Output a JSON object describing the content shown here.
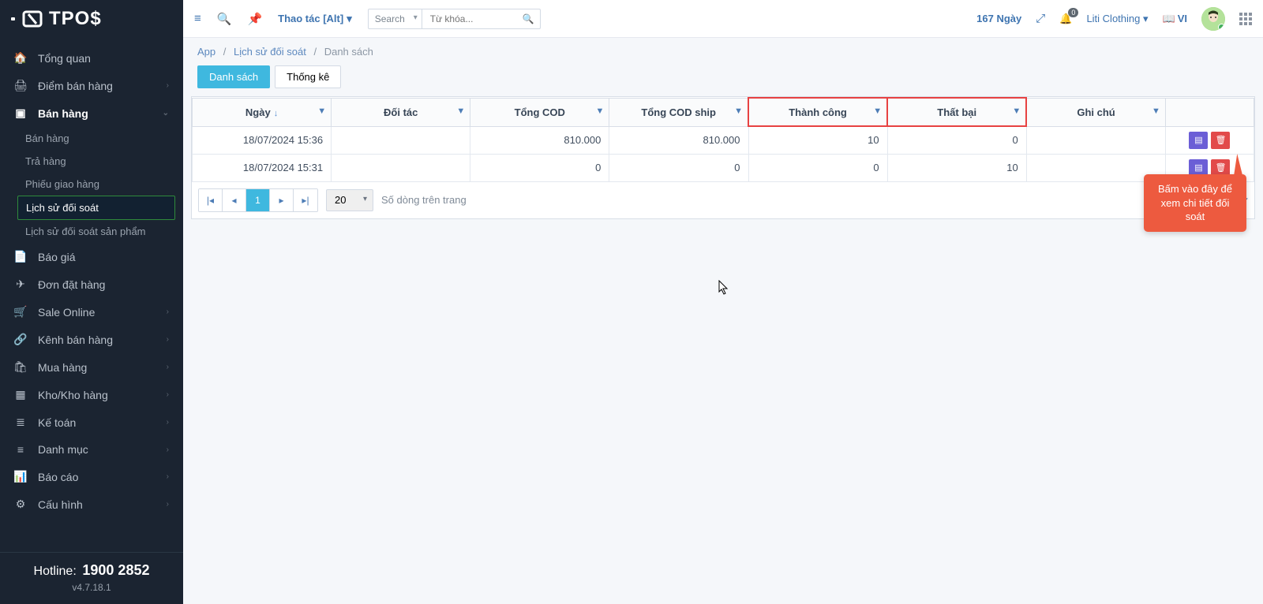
{
  "brand": "TPO$",
  "sidebar": {
    "items": [
      {
        "label": "Tổng quan",
        "icon": "home"
      },
      {
        "label": "Điểm bán hàng",
        "icon": "print"
      },
      {
        "label": "Bán hàng",
        "icon": "book"
      },
      {
        "label": "Báo giá",
        "icon": "file"
      },
      {
        "label": "Đơn đặt hàng",
        "icon": "plane"
      },
      {
        "label": "Sale Online",
        "icon": "cart"
      },
      {
        "label": "Kênh bán hàng",
        "icon": "link"
      },
      {
        "label": "Mua hàng",
        "icon": "cart2"
      },
      {
        "label": "Kho/Kho hàng",
        "icon": "boxes"
      },
      {
        "label": "Kế toán",
        "icon": "list"
      },
      {
        "label": "Danh mục",
        "icon": "list2"
      },
      {
        "label": "Báo cáo",
        "icon": "bars"
      },
      {
        "label": "Cấu hình",
        "icon": "gear"
      }
    ],
    "sales_sub": [
      {
        "label": "Bán hàng"
      },
      {
        "label": "Trả hàng"
      },
      {
        "label": "Phiếu giao hàng"
      },
      {
        "label": "Lịch sử đối soát"
      },
      {
        "label": "Lịch sử đối soát sản phẩm"
      }
    ],
    "hotline_label": "Hotline:",
    "hotline_number": "1900 2852",
    "version": "v4.7.18.1"
  },
  "topbar": {
    "action": "Thao tác [Alt]",
    "search_select": "Search",
    "search_placeholder": "Từ khóa...",
    "days": "167 Ngày",
    "notif_count": "0",
    "user": "Liti Clothing",
    "lang": "VI"
  },
  "breadcrumb": {
    "app": "App",
    "section": "Lịch sử đối soát",
    "page": "Danh sách"
  },
  "tabs": {
    "list": "Danh sách",
    "stats": "Thống kê"
  },
  "table": {
    "cols": [
      "Ngày",
      "Đối tác",
      "Tổng COD",
      "Tổng COD ship",
      "Thành công",
      "Thất bại",
      "Ghi chú",
      ""
    ],
    "rows": [
      {
        "date": "18/07/2024 15:36",
        "partner": "",
        "cod": "810.000",
        "ship": "810.000",
        "success": "10",
        "fail": "0",
        "note": ""
      },
      {
        "date": "18/07/2024 15:31",
        "partner": "",
        "cod": "0",
        "ship": "0",
        "success": "0",
        "fail": "10",
        "note": ""
      }
    ]
  },
  "pager": {
    "page_size": "20",
    "label": "Số dòng trên trang",
    "info_suffix": "ủa 2 dòng",
    "current": "1"
  },
  "callout": "Bấm vào đây để xem chi tiết đối soát"
}
